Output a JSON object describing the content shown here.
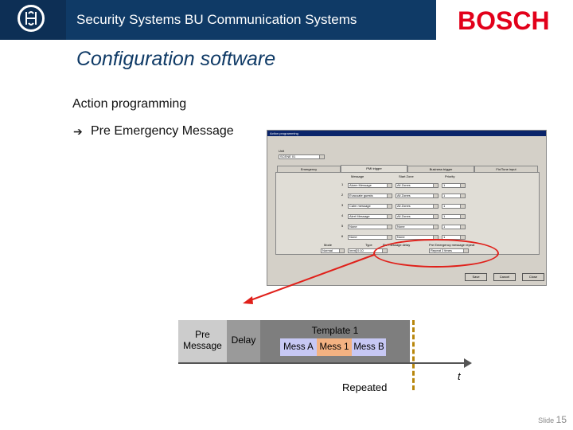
{
  "header": {
    "title": "Security Systems BU Communication Systems",
    "brand": "BOSCH"
  },
  "page": {
    "title": "Configuration software",
    "section": "Action programming",
    "bullet_arrow": "➔",
    "bullet": "Pre Emergency Message"
  },
  "dialog": {
    "title": "Action programming",
    "unit_label": "Unit",
    "unit_value": "SCENE 01",
    "tabs": [
      "Emergency",
      "PMI trigger",
      "Business trigger",
      "Fix/Tune input"
    ],
    "active_tab": 1,
    "col_message": "Message",
    "col_zone": "Start Zone",
    "col_priority": "Priority",
    "rows": [
      {
        "n": "1",
        "message": "Alarm Message",
        "zone": "All Zones",
        "priority": "1"
      },
      {
        "n": "2",
        "message": "Evacuate guests",
        "zone": "All Zones",
        "priority": "1"
      },
      {
        "n": "3",
        "message": "Calm message",
        "zone": "All Zones",
        "priority": "1"
      },
      {
        "n": "4",
        "message": "Alert Message",
        "zone": "All Zones",
        "priority": "1"
      },
      {
        "n": "5",
        "message": "None",
        "zone": "None",
        "priority": "1"
      },
      {
        "n": "6",
        "message": "None",
        "zone": "None",
        "priority": "1"
      }
    ],
    "mode_label": "Mode",
    "mode_value": "Normal",
    "type_label": "Type",
    "type_value": "Immediate",
    "pre_label": "Pre message delay",
    "pre_value": "0:10",
    "repeat_label": "Pre Emergency message repeat",
    "repeat_value": "Repeat 3 times",
    "buttons": [
      "Save",
      "Cancel",
      "Close"
    ]
  },
  "timeline": {
    "pre_line1": "Pre",
    "pre_line2": "Message",
    "delay": "Delay",
    "template": "Template 1",
    "mess_a": "Mess A",
    "mess_1": "Mess 1",
    "mess_b": "Mess B",
    "t": "t",
    "repeated": "Repeated"
  },
  "footer": {
    "slide_label": "Slide",
    "slide_number": "15"
  },
  "colors": {
    "header_band": "#0f3a66",
    "brand_red": "#e2001a",
    "highlight_ellipse": "#e0201a"
  }
}
